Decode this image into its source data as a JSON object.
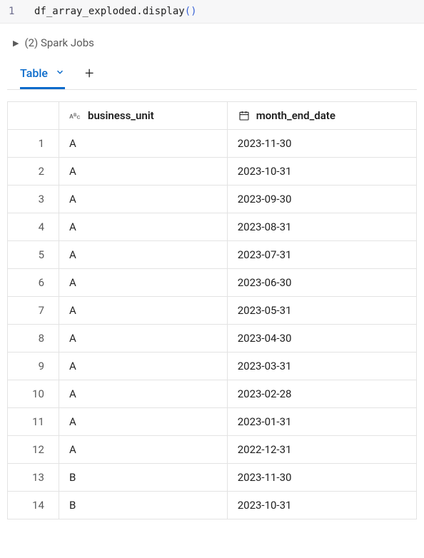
{
  "code": {
    "line_number": "1",
    "text": "df_array_exploded.display",
    "parens": "()"
  },
  "spark_jobs": {
    "label": "(2) Spark Jobs"
  },
  "tabs": {
    "table_label": "Table",
    "add_label": "+"
  },
  "table": {
    "columns": [
      {
        "name": "business_unit"
      },
      {
        "name": "month_end_date"
      }
    ],
    "rows": [
      {
        "n": "1",
        "business_unit": "A",
        "month_end_date": "2023-11-30"
      },
      {
        "n": "2",
        "business_unit": "A",
        "month_end_date": "2023-10-31"
      },
      {
        "n": "3",
        "business_unit": "A",
        "month_end_date": "2023-09-30"
      },
      {
        "n": "4",
        "business_unit": "A",
        "month_end_date": "2023-08-31"
      },
      {
        "n": "5",
        "business_unit": "A",
        "month_end_date": "2023-07-31"
      },
      {
        "n": "6",
        "business_unit": "A",
        "month_end_date": "2023-06-30"
      },
      {
        "n": "7",
        "business_unit": "A",
        "month_end_date": "2023-05-31"
      },
      {
        "n": "8",
        "business_unit": "A",
        "month_end_date": "2023-04-30"
      },
      {
        "n": "9",
        "business_unit": "A",
        "month_end_date": "2023-03-31"
      },
      {
        "n": "10",
        "business_unit": "A",
        "month_end_date": "2023-02-28"
      },
      {
        "n": "11",
        "business_unit": "A",
        "month_end_date": "2023-01-31"
      },
      {
        "n": "12",
        "business_unit": "A",
        "month_end_date": "2022-12-31"
      },
      {
        "n": "13",
        "business_unit": "B",
        "month_end_date": "2023-11-30"
      },
      {
        "n": "14",
        "business_unit": "B",
        "month_end_date": "2023-10-31"
      }
    ]
  }
}
